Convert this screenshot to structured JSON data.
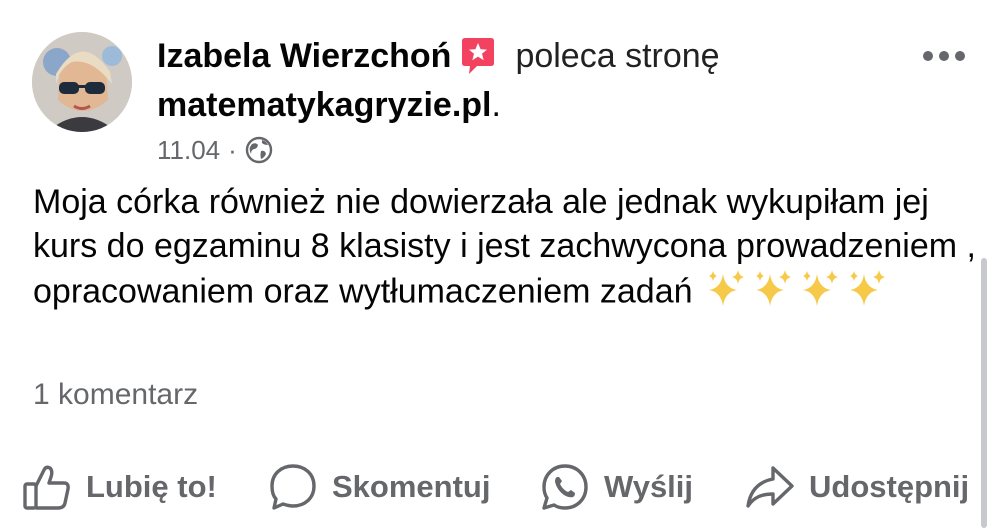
{
  "post": {
    "author": "Izabela Wierzchoń",
    "recommends_text": "poleca stronę",
    "page_name": "matematykagryzie.pl",
    "page_suffix": ".",
    "date": "11.04",
    "separator": "·",
    "audience_icon": "globe-icon",
    "body": "Moja córka również nie dowierzała ale jednak wykupiłam jej kurs do egzaminu 8 klasisty i jest zachwycona prowadzeniem , opracowaniem oraz wytłumaczeniem zadań",
    "emoji": "✨✨✨✨",
    "comments_count": "1 komentarz"
  },
  "actions": {
    "like": "Lubię to!",
    "comment": "Skomentuj",
    "send": "Wyślij",
    "share": "Udostępnij"
  },
  "colors": {
    "text": "#050505",
    "secondary": "#65676b",
    "badge": "#f3425f",
    "sparkle": "#f7c948"
  }
}
